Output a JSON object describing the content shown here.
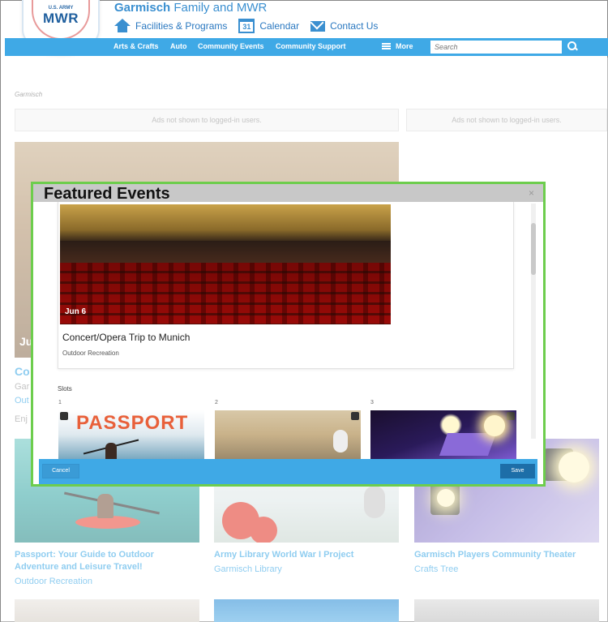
{
  "header": {
    "site_name": "Garmisch",
    "site_suffix": "Family and MWR",
    "logo_top": "U.S. ARMY",
    "logo_main": "MWR",
    "links": [
      {
        "label": "Facilities & Programs",
        "icon": "home-icon"
      },
      {
        "label": "Calendar",
        "icon": "calendar-icon",
        "icon_text": "31"
      },
      {
        "label": "Contact Us",
        "icon": "mail-icon"
      }
    ]
  },
  "nav": {
    "items": [
      "Arts & Crafts",
      "Auto",
      "Community Events",
      "Community Support"
    ],
    "more_label": "More",
    "search_placeholder": "Search"
  },
  "page": {
    "breadcrumb": "Garmisch",
    "ad_text": "Ads not shown to logged-in users.",
    "hero": {
      "date": "Ju",
      "title": "Co",
      "location": "Gar",
      "category": "Out",
      "desc": "Enj"
    },
    "cards": [
      {
        "title": "Passport: Your Guide to Outdoor Adventure and Leisure Travel!",
        "sub": "Outdoor Recreation"
      },
      {
        "title": "Army Library World War I Project",
        "sub": "Garmisch Library"
      },
      {
        "title": "Garmisch Players Community Theater",
        "sub": "Crafts Tree"
      }
    ]
  },
  "modal": {
    "title": "Featured Events",
    "close_label": "×",
    "event": {
      "date": "Jun 6",
      "name": "Concert/Opera Trip to Munich",
      "category": "Outdoor Recreation"
    },
    "slots_label": "Slots",
    "slot_numbers": [
      "1",
      "2",
      "3"
    ],
    "slot1_text": "PASSPORT",
    "cancel_label": "Cancel",
    "save_label": "Save"
  },
  "colors": {
    "accent": "#3fa9e6",
    "modal_border": "#6dcd4d",
    "save_button": "#1d6ea8"
  }
}
